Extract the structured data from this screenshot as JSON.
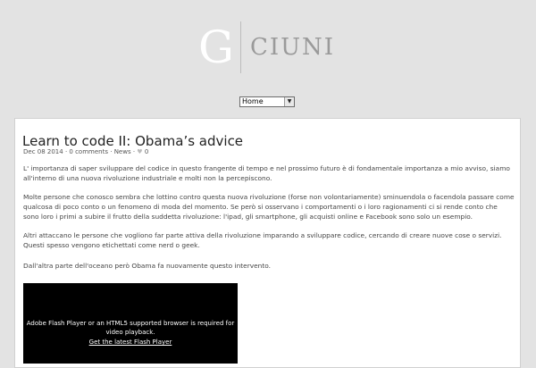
{
  "site": {
    "logo_letter": "G",
    "logo_text": "CIUNI"
  },
  "nav": {
    "selected": "Home"
  },
  "post": {
    "title": "Learn to code II: Obama’s advice",
    "date": "Dec 08 2014",
    "comments": "0 comments",
    "category": "News",
    "likes": "0",
    "paragraphs": [
      "L' importanza di saper sviluppare del codice in questo frangente di tempo e nel prossimo futuro è di fondamentale importanza a mio avviso, siamo all'interno di una nuova rivoluzione industriale e molti non la percepiscono.",
      "Molte persone che conosco sembra che lottino contro questa nuova rivoluzione (forse non volontariamente) sminuendola o facendola passare come qualcosa di poco conto o un fenomeno di moda del momento. Se però si osservano i  comportamenti o i loro ragionamenti ci si rende conto che sono loro i primi a subire il frutto della suddetta rivoluzione: l'ipad, gli smartphone, gli acquisti online e Facebook sono solo un esempio.",
      "Altri attaccano le persone che vogliono far parte attiva della rivoluzione imparando a sviluppare codice, cercando di creare nuove cose o servizi. Questi spesso vengono etichettati come nerd o geek.",
      "Dall'altra parte dell'oceano però Obama fa nuovamente questo intervento."
    ]
  },
  "video": {
    "message": "Adobe Flash Player or an HTML5 supported browser is required for video playback.",
    "link": "Get the latest Flash Player"
  }
}
